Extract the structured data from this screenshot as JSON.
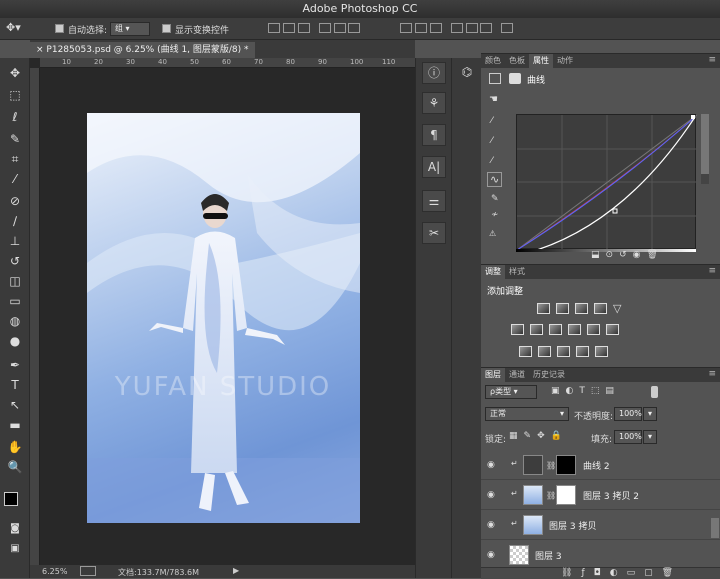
{
  "app": {
    "title": "Adobe Photoshop CC"
  },
  "options": {
    "auto_select_label": "自动选择:",
    "auto_select_value": "组",
    "show_transform_label": "显示变换控件"
  },
  "document": {
    "tab_title": "P1285053.psd @ 6.25% (曲线 1, 图层蒙版/8) *",
    "ruler_ticks": [
      "10",
      "20",
      "30",
      "40",
      "50",
      "60",
      "70",
      "80",
      "90",
      "100",
      "110"
    ],
    "watermark": "YUFAN STUDIO"
  },
  "status": {
    "zoom": "6.25%",
    "doc_size": "文档:133.7M/783.6M"
  },
  "properties_panel": {
    "tabs": [
      "颜色",
      "色板",
      "属性",
      "动作"
    ],
    "active_tab": "属性",
    "title": "曲线"
  },
  "adjustments_panel": {
    "tabs": [
      "调整",
      "样式"
    ],
    "subtitle": "添加调整"
  },
  "layers_panel": {
    "tabs": [
      "图层",
      "通道",
      "历史记录"
    ],
    "filter_label": "ρ类型",
    "blend_mode": "正常",
    "opacity_label": "不透明度:",
    "opacity_value": "100%",
    "lock_label": "锁定:",
    "fill_label": "填充:",
    "fill_value": "100%",
    "layers": [
      {
        "name": "曲线 2"
      },
      {
        "name": "图层 3 拷贝 2"
      },
      {
        "name": "图层 3 拷贝"
      },
      {
        "name": "图层 3"
      }
    ]
  },
  "colors": {
    "ui_dark": "#3a3a3a",
    "ui_mid": "#535353",
    "photo_blue": "#8fb0e3"
  }
}
